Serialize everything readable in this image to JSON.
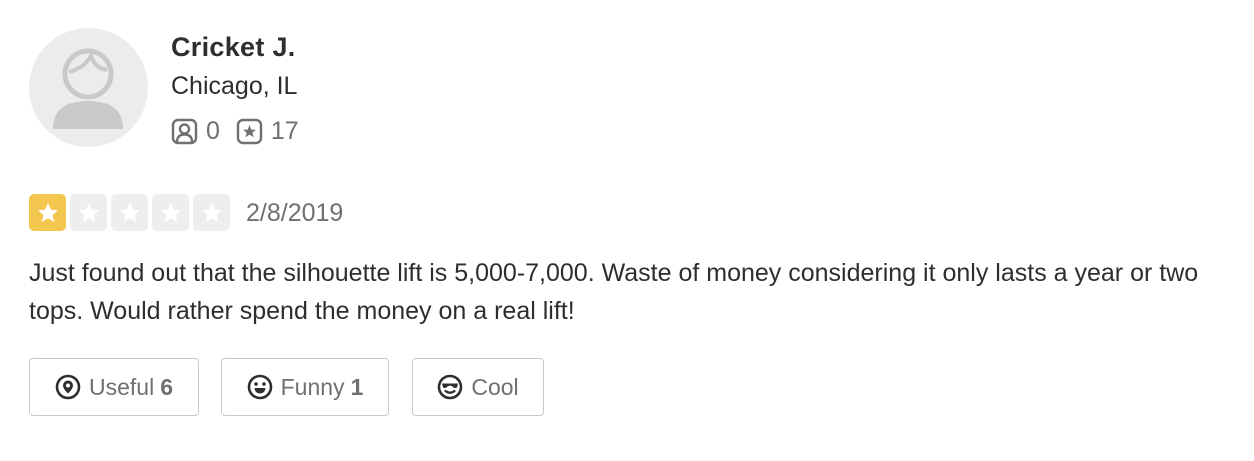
{
  "user": {
    "name": "Cricket J.",
    "location": "Chicago, IL",
    "friends_count": "0",
    "reviews_count": "17",
    "avatar_icon": "default-user-avatar-icon"
  },
  "review": {
    "rating": 1,
    "max_rating": 5,
    "star_color": "#f3c74d",
    "date": "2/8/2019",
    "text": "Just found out that the silhouette lift is 5,000-7,000. Waste of money considering it only lasts a year or two tops. Would rather spend the money on a real lift!"
  },
  "reactions": {
    "useful": {
      "label": "Useful",
      "count": "6",
      "icon": "useful-icon"
    },
    "funny": {
      "label": "Funny",
      "count": "1",
      "icon": "funny-icon"
    },
    "cool": {
      "label": "Cool",
      "icon": "cool-icon"
    }
  }
}
